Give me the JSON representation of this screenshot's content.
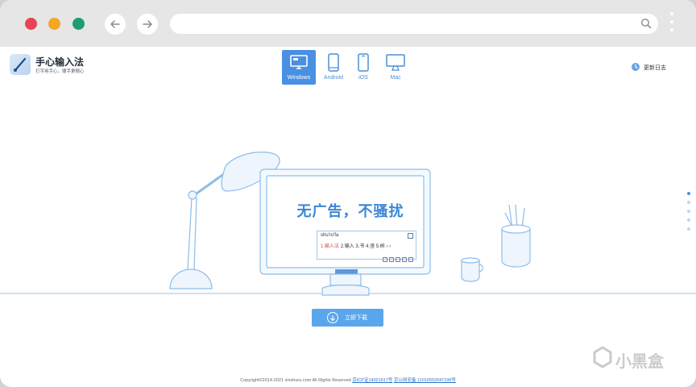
{
  "browser": {
    "url": "",
    "search_icon": "search-icon",
    "back_icon": "arrow-left-icon",
    "forward_icon": "arrow-right-icon",
    "menu_icon": "kebab-menu-icon",
    "colors": {
      "close": "#e64553",
      "minimize": "#f5a623",
      "maximize": "#1f9d6f"
    }
  },
  "header": {
    "logo_name": "手心输入法",
    "logo_slogan": "打字用手心，顺手更随心",
    "changelog_label": "更新日志"
  },
  "platform_tabs": [
    {
      "label": "Windows",
      "icon": "desktop-monitor-icon",
      "active": true
    },
    {
      "label": "Android",
      "icon": "android-phone-icon",
      "active": false
    },
    {
      "label": "iOS",
      "icon": "iphone-icon",
      "active": false
    },
    {
      "label": "Mac",
      "icon": "mac-monitor-icon",
      "active": false
    }
  ],
  "hero": {
    "headline": "无广告，不骚扰",
    "ime_pinyin": "shu'ru'fa",
    "ime_candidates": [
      "1.输入法",
      "2.输入",
      "3.书",
      "4.竖",
      "5.树"
    ],
    "monitor_brand": "手心输入法"
  },
  "download": {
    "label": "立即下载"
  },
  "footer": {
    "copyright": "Copyright©2014-2021 xinshuru.com All Rights Reserved",
    "icp": "京ICP证14021617号",
    "police": "京公网安备 11010502047196号"
  },
  "side_nav": {
    "count": 5,
    "active_index": 0
  },
  "watermark": "小黑盒",
  "accent_color": "#4a90e2"
}
